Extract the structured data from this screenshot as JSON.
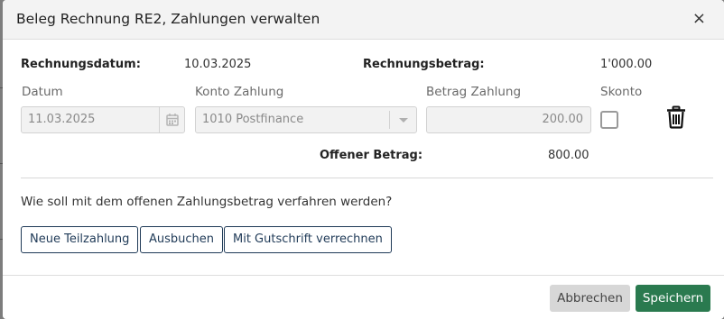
{
  "dialog": {
    "title": "Beleg Rechnung RE2, Zahlungen verwalten",
    "close_symbol": "×"
  },
  "invoice": {
    "date_label": "Rechnungsdatum:",
    "date_value": "10.03.2025",
    "amount_label": "Rechnungsbetrag:",
    "amount_value": "1'000.00"
  },
  "payment": {
    "date_label": "Datum",
    "date_value": "11.03.2025",
    "account_label": "Konto Zahlung",
    "account_value": "1010 Postfinance",
    "amount_label": "Betrag Zahlung",
    "amount_value": "200.00",
    "discount_label": "Skonto",
    "discount_checked": false
  },
  "open_amount": {
    "label": "Offener Betrag:",
    "value": "800.00"
  },
  "question": "Wie soll mit dem offenen Zahlungsbetrag verfahren werden?",
  "actions": {
    "new_partial": "Neue Teilzahlung",
    "write_off": "Ausbuchen",
    "credit_note": "Mit Gutschrift verrechnen"
  },
  "footer": {
    "cancel": "Abbrechen",
    "save": "Speichern"
  },
  "icons": {
    "close": "close-icon",
    "calendar": "calendar-icon",
    "dropdown": "chevron-down-icon",
    "delete": "trash-icon"
  },
  "colors": {
    "primary_outline": "#1f3a57",
    "save_button": "#2a7a4f",
    "cancel_button": "#d7d7d7"
  }
}
